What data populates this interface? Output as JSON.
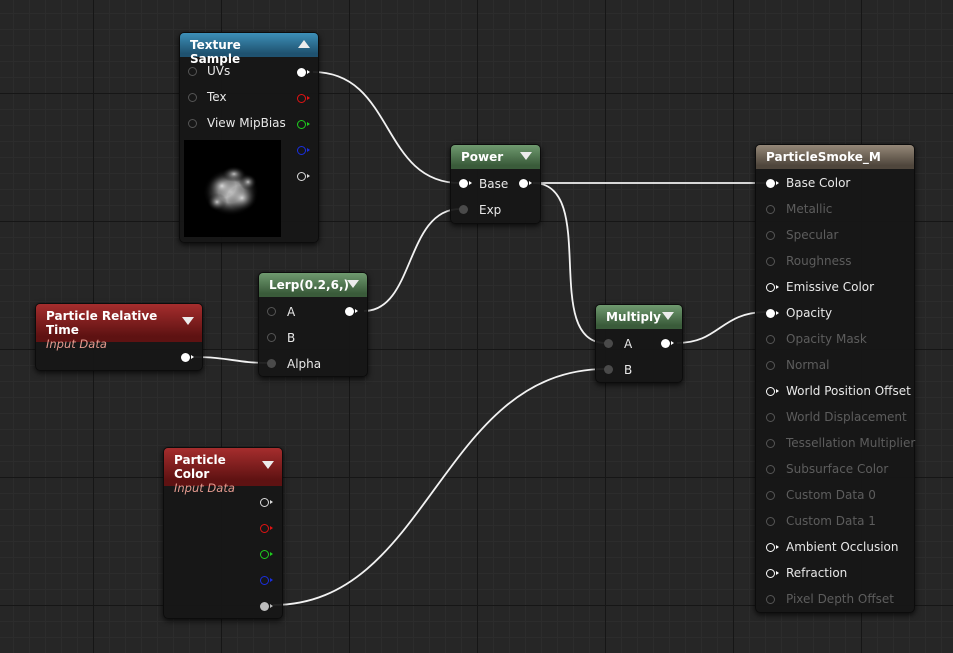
{
  "texture_sample": {
    "title": "Texture Sample",
    "inputs": [
      "UVs",
      "Tex",
      "View MipBias"
    ]
  },
  "power": {
    "title": "Power",
    "inputs": [
      "Base",
      "Exp"
    ]
  },
  "lerp": {
    "title": "Lerp(0.2,6,)",
    "inputs": [
      "A",
      "B",
      "Alpha"
    ]
  },
  "particle_relative_time": {
    "title": "Particle Relative Time",
    "subtitle": "Input Data"
  },
  "multiply": {
    "title": "Multiply",
    "inputs": [
      "A",
      "B"
    ]
  },
  "particle_color": {
    "title": "Particle Color",
    "subtitle": "Input Data"
  },
  "material": {
    "title": "ParticleSmoke_M",
    "inputs": [
      "Base Color",
      "Metallic",
      "Specular",
      "Roughness",
      "Emissive Color",
      "Opacity",
      "Opacity Mask",
      "Normal",
      "World Position Offset",
      "World Displacement",
      "Tessellation Multiplier",
      "Subsurface Color",
      "Custom Data 0",
      "Custom Data 1",
      "Ambient Occlusion",
      "Refraction",
      "Pixel Depth Offset"
    ]
  },
  "colors": {
    "grid_background": "#262626",
    "wire": "#ffffff",
    "pin_red": "#e21313",
    "pin_green": "#1fce1f",
    "pin_blue": "#1a2fe0",
    "header_texture": "#2f6f94",
    "header_math": "#557a55",
    "header_input": "#8a1f1f",
    "header_material": "#7a6f62"
  }
}
